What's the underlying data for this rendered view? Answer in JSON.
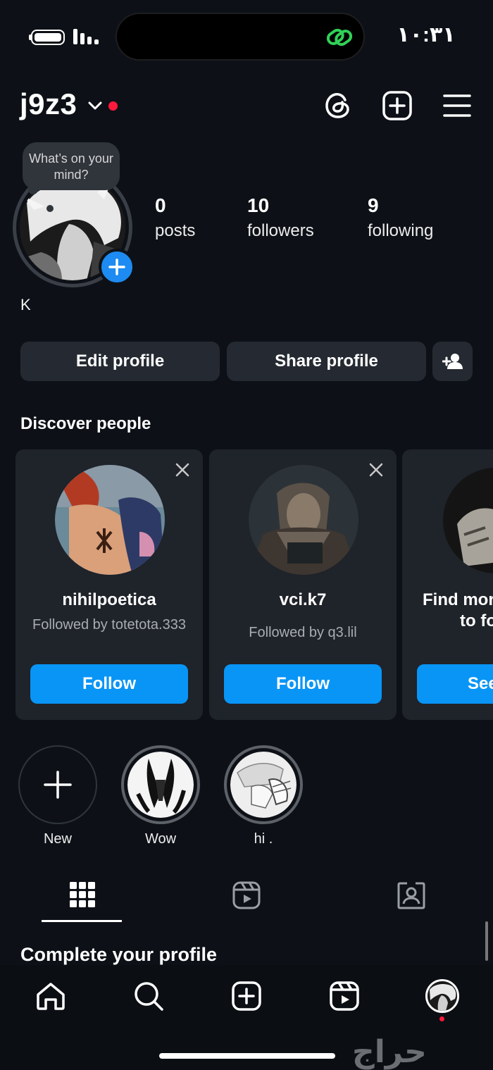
{
  "status_bar": {
    "time": "١٠:٣١"
  },
  "header": {
    "username": "j9z3",
    "icons": [
      "chevron-down-icon",
      "threads-icon",
      "create-icon",
      "menu-icon"
    ]
  },
  "profile": {
    "note_bubble": "What’s on your mind?",
    "stats": [
      {
        "value": "0",
        "label": "posts"
      },
      {
        "value": "10",
        "label": "followers"
      },
      {
        "value": "9",
        "label": "following"
      }
    ],
    "bio": "K"
  },
  "actions": {
    "edit_profile": "Edit profile",
    "share_profile": "Share profile"
  },
  "discover": {
    "title": "Discover people",
    "cards": [
      {
        "username": "nihilpoetica",
        "subtitle": "Followed by totetota.333",
        "button": "Follow"
      },
      {
        "username": "vci.k7",
        "subtitle": "Followed by q3.lil",
        "button": "Follow"
      },
      {
        "username": "Find mor",
        "subtitle": "to fo",
        "button": "See"
      }
    ]
  },
  "highlights": [
    {
      "label": "New"
    },
    {
      "label": "Wow"
    },
    {
      "label": "hi ."
    }
  ],
  "tabs": [
    "grid-icon",
    "reels-icon",
    "tagged-icon"
  ],
  "complete_profile": {
    "title": "Complete your profile"
  },
  "bottom_nav": [
    "home-icon",
    "search-icon",
    "create-icon",
    "reels-icon",
    "profile-avatar"
  ],
  "watermark": "حراج",
  "colors": {
    "background": "#0d1117",
    "follow_button": "#0995f6",
    "notification_dot": "#ff1a3c",
    "link_icon": "#30d158"
  }
}
